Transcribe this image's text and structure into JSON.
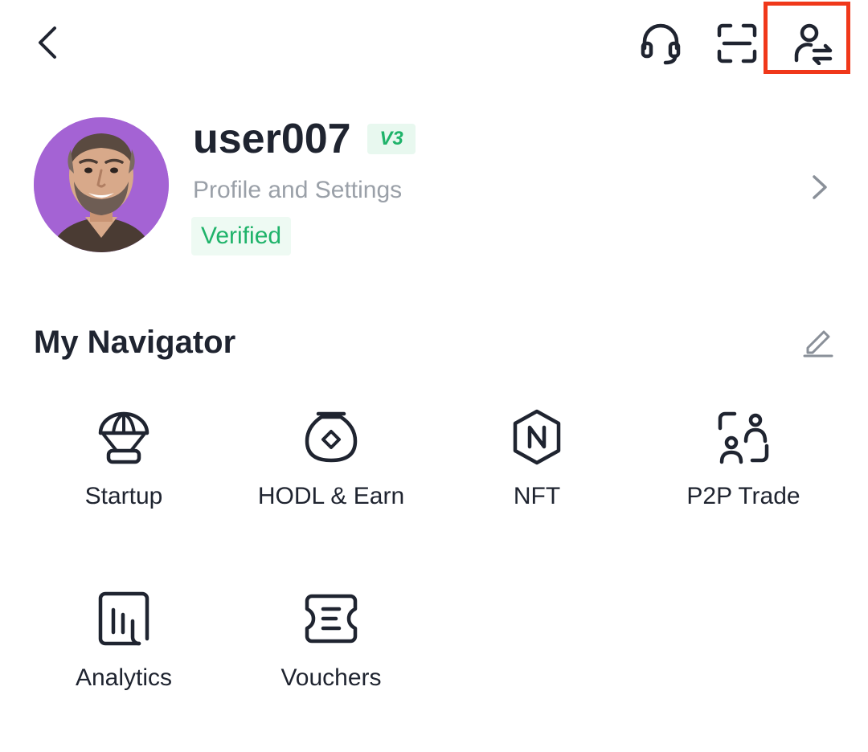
{
  "header": {
    "back_icon": "chevron-left-icon",
    "support_icon": "headset-icon",
    "scan_icon": "scan-icon",
    "switch_account_icon": "user-switch-icon",
    "highlight_color": "#f0381a"
  },
  "profile": {
    "username": "user007",
    "level": "V3",
    "subtitle": "Profile and Settings",
    "status": "Verified",
    "avatar_bg": "#a463d4",
    "accent_green": "#1fb36a"
  },
  "navigator": {
    "title": "My Navigator",
    "edit_icon": "pencil-icon",
    "items": [
      {
        "label": "Startup",
        "icon": "parachute-icon"
      },
      {
        "label": "HODL & Earn",
        "icon": "pot-icon"
      },
      {
        "label": "NFT",
        "icon": "nft-icon"
      },
      {
        "label": "P2P Trade",
        "icon": "p2p-icon"
      },
      {
        "label": "Analytics",
        "icon": "analytics-icon"
      },
      {
        "label": "Vouchers",
        "icon": "voucher-icon"
      }
    ]
  }
}
